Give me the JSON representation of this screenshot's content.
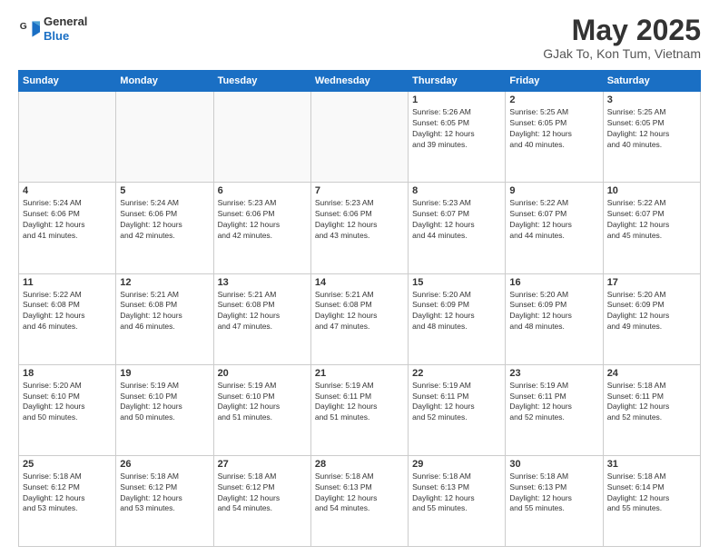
{
  "logo": {
    "line1": "General",
    "line2": "Blue"
  },
  "title": "May 2025",
  "subtitle": "GJak To, Kon Tum, Vietnam",
  "weekdays": [
    "Sunday",
    "Monday",
    "Tuesday",
    "Wednesday",
    "Thursday",
    "Friday",
    "Saturday"
  ],
  "weeks": [
    [
      {
        "day": "",
        "detail": "",
        "empty": true
      },
      {
        "day": "",
        "detail": "",
        "empty": true
      },
      {
        "day": "",
        "detail": "",
        "empty": true
      },
      {
        "day": "",
        "detail": "",
        "empty": true
      },
      {
        "day": "1",
        "detail": "Sunrise: 5:26 AM\nSunset: 6:05 PM\nDaylight: 12 hours\nand 39 minutes.",
        "empty": false
      },
      {
        "day": "2",
        "detail": "Sunrise: 5:25 AM\nSunset: 6:05 PM\nDaylight: 12 hours\nand 40 minutes.",
        "empty": false
      },
      {
        "day": "3",
        "detail": "Sunrise: 5:25 AM\nSunset: 6:05 PM\nDaylight: 12 hours\nand 40 minutes.",
        "empty": false
      }
    ],
    [
      {
        "day": "4",
        "detail": "Sunrise: 5:24 AM\nSunset: 6:06 PM\nDaylight: 12 hours\nand 41 minutes.",
        "empty": false
      },
      {
        "day": "5",
        "detail": "Sunrise: 5:24 AM\nSunset: 6:06 PM\nDaylight: 12 hours\nand 42 minutes.",
        "empty": false
      },
      {
        "day": "6",
        "detail": "Sunrise: 5:23 AM\nSunset: 6:06 PM\nDaylight: 12 hours\nand 42 minutes.",
        "empty": false
      },
      {
        "day": "7",
        "detail": "Sunrise: 5:23 AM\nSunset: 6:06 PM\nDaylight: 12 hours\nand 43 minutes.",
        "empty": false
      },
      {
        "day": "8",
        "detail": "Sunrise: 5:23 AM\nSunset: 6:07 PM\nDaylight: 12 hours\nand 44 minutes.",
        "empty": false
      },
      {
        "day": "9",
        "detail": "Sunrise: 5:22 AM\nSunset: 6:07 PM\nDaylight: 12 hours\nand 44 minutes.",
        "empty": false
      },
      {
        "day": "10",
        "detail": "Sunrise: 5:22 AM\nSunset: 6:07 PM\nDaylight: 12 hours\nand 45 minutes.",
        "empty": false
      }
    ],
    [
      {
        "day": "11",
        "detail": "Sunrise: 5:22 AM\nSunset: 6:08 PM\nDaylight: 12 hours\nand 46 minutes.",
        "empty": false
      },
      {
        "day": "12",
        "detail": "Sunrise: 5:21 AM\nSunset: 6:08 PM\nDaylight: 12 hours\nand 46 minutes.",
        "empty": false
      },
      {
        "day": "13",
        "detail": "Sunrise: 5:21 AM\nSunset: 6:08 PM\nDaylight: 12 hours\nand 47 minutes.",
        "empty": false
      },
      {
        "day": "14",
        "detail": "Sunrise: 5:21 AM\nSunset: 6:08 PM\nDaylight: 12 hours\nand 47 minutes.",
        "empty": false
      },
      {
        "day": "15",
        "detail": "Sunrise: 5:20 AM\nSunset: 6:09 PM\nDaylight: 12 hours\nand 48 minutes.",
        "empty": false
      },
      {
        "day": "16",
        "detail": "Sunrise: 5:20 AM\nSunset: 6:09 PM\nDaylight: 12 hours\nand 48 minutes.",
        "empty": false
      },
      {
        "day": "17",
        "detail": "Sunrise: 5:20 AM\nSunset: 6:09 PM\nDaylight: 12 hours\nand 49 minutes.",
        "empty": false
      }
    ],
    [
      {
        "day": "18",
        "detail": "Sunrise: 5:20 AM\nSunset: 6:10 PM\nDaylight: 12 hours\nand 50 minutes.",
        "empty": false
      },
      {
        "day": "19",
        "detail": "Sunrise: 5:19 AM\nSunset: 6:10 PM\nDaylight: 12 hours\nand 50 minutes.",
        "empty": false
      },
      {
        "day": "20",
        "detail": "Sunrise: 5:19 AM\nSunset: 6:10 PM\nDaylight: 12 hours\nand 51 minutes.",
        "empty": false
      },
      {
        "day": "21",
        "detail": "Sunrise: 5:19 AM\nSunset: 6:11 PM\nDaylight: 12 hours\nand 51 minutes.",
        "empty": false
      },
      {
        "day": "22",
        "detail": "Sunrise: 5:19 AM\nSunset: 6:11 PM\nDaylight: 12 hours\nand 52 minutes.",
        "empty": false
      },
      {
        "day": "23",
        "detail": "Sunrise: 5:19 AM\nSunset: 6:11 PM\nDaylight: 12 hours\nand 52 minutes.",
        "empty": false
      },
      {
        "day": "24",
        "detail": "Sunrise: 5:18 AM\nSunset: 6:11 PM\nDaylight: 12 hours\nand 52 minutes.",
        "empty": false
      }
    ],
    [
      {
        "day": "25",
        "detail": "Sunrise: 5:18 AM\nSunset: 6:12 PM\nDaylight: 12 hours\nand 53 minutes.",
        "empty": false
      },
      {
        "day": "26",
        "detail": "Sunrise: 5:18 AM\nSunset: 6:12 PM\nDaylight: 12 hours\nand 53 minutes.",
        "empty": false
      },
      {
        "day": "27",
        "detail": "Sunrise: 5:18 AM\nSunset: 6:12 PM\nDaylight: 12 hours\nand 54 minutes.",
        "empty": false
      },
      {
        "day": "28",
        "detail": "Sunrise: 5:18 AM\nSunset: 6:13 PM\nDaylight: 12 hours\nand 54 minutes.",
        "empty": false
      },
      {
        "day": "29",
        "detail": "Sunrise: 5:18 AM\nSunset: 6:13 PM\nDaylight: 12 hours\nand 55 minutes.",
        "empty": false
      },
      {
        "day": "30",
        "detail": "Sunrise: 5:18 AM\nSunset: 6:13 PM\nDaylight: 12 hours\nand 55 minutes.",
        "empty": false
      },
      {
        "day": "31",
        "detail": "Sunrise: 5:18 AM\nSunset: 6:14 PM\nDaylight: 12 hours\nand 55 minutes.",
        "empty": false
      }
    ]
  ]
}
